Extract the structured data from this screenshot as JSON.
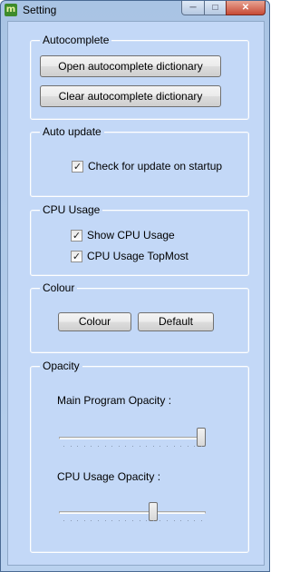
{
  "window": {
    "title": "Setting",
    "icon": "app-icon",
    "icon_glyph": "m"
  },
  "titlebar_buttons": {
    "minimize": "─",
    "maximize": "□",
    "close": "✕"
  },
  "autocomplete": {
    "label": "Autocomplete",
    "open_button": "Open autocomplete dictionary",
    "clear_button": "Clear autocomplete dictionary"
  },
  "auto_update": {
    "label": "Auto update",
    "check_startup": {
      "label": "Check for update on startup",
      "checked": true
    }
  },
  "cpu_usage": {
    "label": "CPU Usage",
    "show": {
      "label": "Show CPU Usage",
      "checked": true
    },
    "topmost": {
      "label": "CPU Usage TopMost",
      "checked": true
    }
  },
  "colour": {
    "label": "Colour",
    "colour_button": "Colour",
    "default_button": "Default"
  },
  "opacity": {
    "label": "Opacity",
    "main_label": "Main Program  Opacity :",
    "main_value_fraction": 1.0,
    "cpu_label": "CPU Usage Opacity :",
    "cpu_value_fraction": 0.65
  },
  "check_glyph": "✓"
}
